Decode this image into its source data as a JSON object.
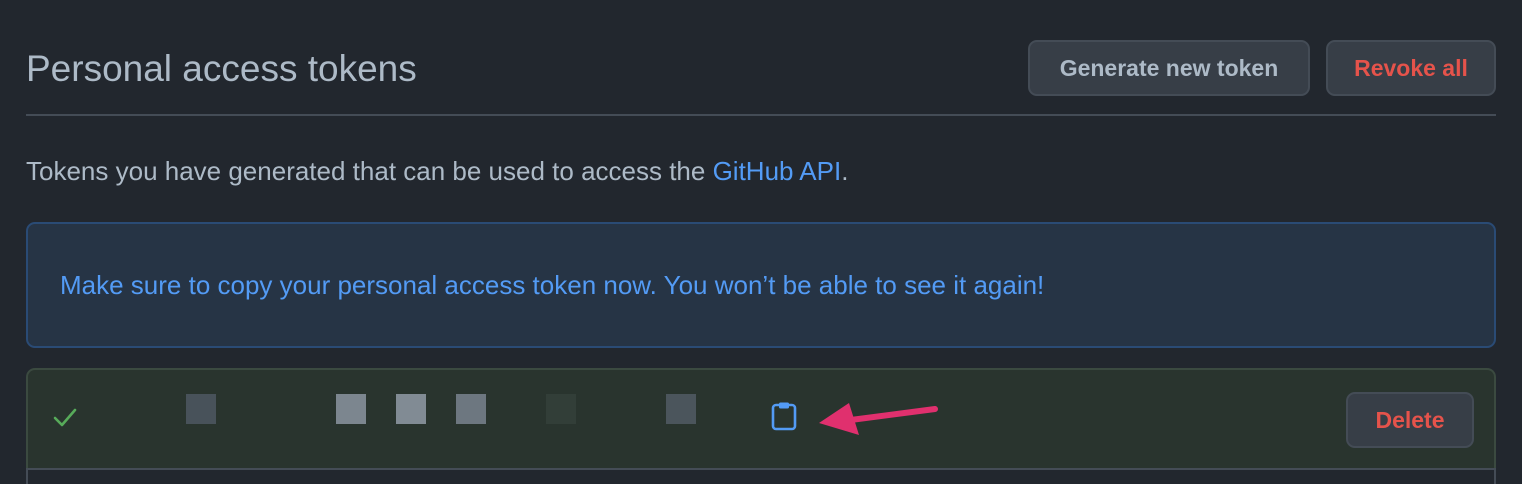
{
  "header": {
    "title": "Personal access tokens",
    "generate_label": "Generate new token",
    "revoke_label": "Revoke all"
  },
  "description": {
    "prefix": "Tokens you have generated that can be used to access the ",
    "link_text": "GitHub API",
    "suffix": "."
  },
  "flash": {
    "message": "Make sure to copy your personal access token now. You won’t be able to see it again!"
  },
  "token_row": {
    "delete_label": "Delete",
    "status_icon": "check-icon",
    "copy_icon": "clipboard-icon"
  },
  "colors": {
    "background": "#22272e",
    "link": "#539bf5",
    "danger": "#e5534b",
    "success": "#57ab5a",
    "annotation_arrow": "#e0306e"
  }
}
